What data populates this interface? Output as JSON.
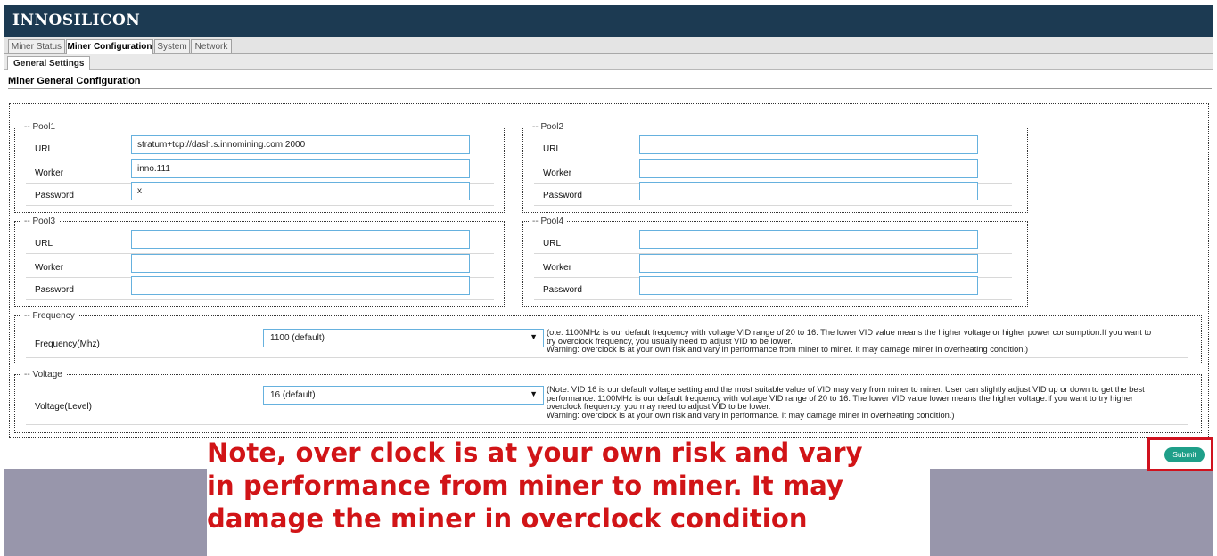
{
  "app": {
    "logo": "INNOSILICON"
  },
  "tabs": [
    {
      "label": "Miner Status",
      "active": false
    },
    {
      "label": "Miner Configuration",
      "active": true
    },
    {
      "label": "System",
      "active": false
    },
    {
      "label": "Network",
      "active": false
    }
  ],
  "subtab": {
    "label": "General Settings"
  },
  "section_title": "Miner General Configuration",
  "pools": [
    {
      "legend": "Pool1",
      "url_label": "URL",
      "url": "stratum+tcp://dash.s.innomining.com:2000",
      "worker_label": "Worker",
      "worker": "inno.111",
      "password_label": "Password",
      "password": "x"
    },
    {
      "legend": "Pool2",
      "url_label": "URL",
      "url": "",
      "worker_label": "Worker",
      "worker": "",
      "password_label": "Password",
      "password": ""
    },
    {
      "legend": "Pool3",
      "url_label": "URL",
      "url": "",
      "worker_label": "Worker",
      "worker": "",
      "password_label": "Password",
      "password": ""
    },
    {
      "legend": "Pool4",
      "url_label": "URL",
      "url": "",
      "worker_label": "Worker",
      "worker": "",
      "password_label": "Password",
      "password": ""
    }
  ],
  "frequency": {
    "legend": "Frequency",
    "label": "Frequency(Mhz)",
    "selected": "1100 (default)",
    "note_lines": [
      "(ote: 1100MHz is our default frequency with voltage VID range of 20 to 16. The lower VID value means the higher voltage or higher power consumption.If you want to",
      "try overclock frequency, you usually need to adjust VID to be lower.",
      "Warning: overclock is at your own risk and vary in performance from miner to miner. It may damage miner in overheating condition.)"
    ]
  },
  "voltage": {
    "legend": "Voltage",
    "label": "Voltage(Level)",
    "selected": "16 (default)",
    "note_lines": [
      "(Note: VID 16 is our default voltage setting and the most suitable value of VID may vary from miner to miner. User can slightly adjust VID up or down to get the best",
      "performance. 1100MHz is our default frequency with voltage VID range of 20 to 16. The lower VID value lower means the higher voltage.If you want to try higher",
      "overclock frequency, you may need to adjust VID to be lower.",
      "Warning: overclock is at your own risk and vary in performance. It may damage miner in overheating condition.)"
    ]
  },
  "submit": {
    "label": "Submit"
  },
  "warning_banner": {
    "line1": "Note, over clock is at your own risk and vary",
    "line2": "in performance from miner to miner. It may",
    "line3": "damage the miner in overclock condition"
  },
  "colors": {
    "topbar": "#1c3a52",
    "input_border": "#66b1de",
    "submit_button": "#1f9f89",
    "highlight_red": "#d0121e",
    "footer": "#9896ab"
  }
}
